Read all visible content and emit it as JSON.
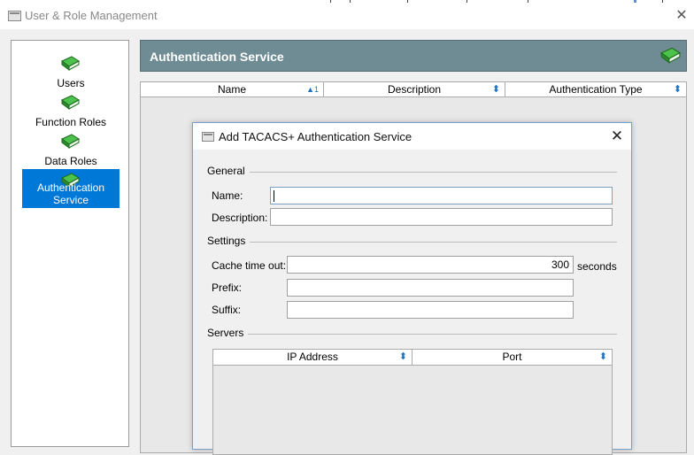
{
  "window": {
    "title": "User & Role Management",
    "close_glyph": "✕"
  },
  "sidebar": {
    "items": [
      {
        "label": "Users",
        "icon": "green-book-icon",
        "selected": false
      },
      {
        "label": "Function Roles",
        "icon": "green-book-icon",
        "selected": false
      },
      {
        "label": "Data Roles",
        "icon": "green-book-icon",
        "selected": false
      },
      {
        "label": "Authentication Service",
        "icon": "green-book-icon",
        "selected": true
      }
    ]
  },
  "section": {
    "title": "Authentication Service",
    "header_color": "#6f8b94",
    "columns": [
      {
        "label": "Name",
        "sort": "▲1"
      },
      {
        "label": "Description",
        "sort": "⬍"
      },
      {
        "label": "Authentication Type",
        "sort": "⬍"
      }
    ]
  },
  "dialog": {
    "title": "Add TACACS+ Authentication Service",
    "close_glyph": "✕",
    "general": {
      "label": "General",
      "name_label": "Name:",
      "name_value": "",
      "description_label": "Description:",
      "description_value": ""
    },
    "settings": {
      "label": "Settings",
      "cache_label": "Cache time out:",
      "cache_value": "300",
      "cache_unit": "seconds",
      "prefix_label": "Prefix:",
      "prefix_value": "",
      "suffix_label": "Suffix:",
      "suffix_value": ""
    },
    "servers": {
      "label": "Servers",
      "columns": [
        {
          "label": "IP Address",
          "sort": "⬍"
        },
        {
          "label": "Port",
          "sort": "⬍"
        }
      ]
    }
  },
  "colors": {
    "selection": "#0078d7",
    "accent_blue": "#1e73be",
    "book_green": "#3aa63a"
  }
}
